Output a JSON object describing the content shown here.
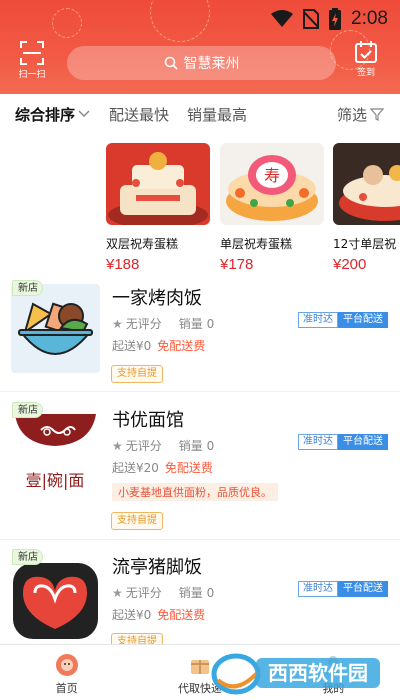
{
  "status": {
    "time": "2:08"
  },
  "header": {
    "scan_label": "扫一扫",
    "search_placeholder": "智慧莱州",
    "signin_label": "签到"
  },
  "sort_bar": {
    "items": [
      "综合排序",
      "配送最快",
      "销量最高"
    ],
    "filter_label": "筛选"
  },
  "featured": [
    {
      "name": "双层祝寿蛋糕",
      "price": "¥188"
    },
    {
      "name": "单层祝寿蛋糕",
      "price": "¥178"
    },
    {
      "name": "12寸单层祝",
      "price": "¥200"
    }
  ],
  "stores": [
    {
      "new_tag": "新店",
      "name": "一家烤肉饭",
      "rating": "无评分",
      "sales": "销量 0",
      "min_order": "起送¥0",
      "delivery_fee": "免配送费",
      "tag_ontime": "准时达",
      "tag_platform": "平台配送",
      "pickup": "支持自提"
    },
    {
      "new_tag": "新店",
      "name": "书优面馆",
      "rating": "无评分",
      "sales": "销量 0",
      "min_order": "起送¥20",
      "delivery_fee": "免配送费",
      "tag_ontime": "准时达",
      "tag_platform": "平台配送",
      "promo": "小麦基地直供面粉，品质优良。",
      "pickup": "支持自提",
      "logo_text": "壹|碗|面"
    },
    {
      "new_tag": "新店",
      "name": "流亭猪脚饭",
      "rating": "无评分",
      "sales": "销量 0",
      "min_order": "起送¥0",
      "delivery_fee": "免配送费",
      "tag_ontime": "准时达",
      "tag_platform": "平台配送",
      "pickup": "支持自提"
    }
  ],
  "bottom_nav": {
    "items": [
      {
        "label": "首页",
        "active": true
      },
      {
        "label": "代取快递",
        "active": false
      },
      {
        "label": "我的",
        "active": false
      }
    ]
  },
  "watermark": {
    "text": "西西软件园"
  },
  "colors": {
    "accent": "#ef4b3a",
    "price": "#e0242a",
    "platform": "#3a8ee6"
  }
}
